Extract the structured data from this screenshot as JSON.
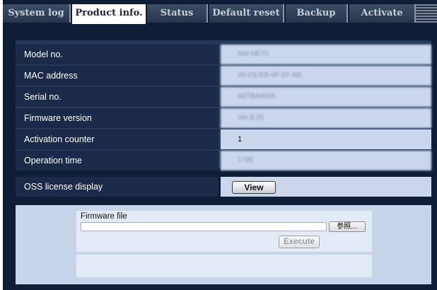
{
  "tabs": [
    {
      "label": "System log",
      "active": false
    },
    {
      "label": "Product info.",
      "active": true
    },
    {
      "label": "Status",
      "active": false
    },
    {
      "label": "Default reset",
      "active": false
    },
    {
      "label": "Backup",
      "active": false
    },
    {
      "label": "Activate",
      "active": false
    }
  ],
  "product_info": {
    "rows": [
      {
        "label": "Model no.",
        "value": "AW-HE70"
      },
      {
        "label": "MAC address",
        "value": "20-C6-EB-0F-07-AB"
      },
      {
        "label": "Serial no.",
        "value": "A0TBA0096"
      },
      {
        "label": "Firmware version",
        "value": "Ver.8.20"
      },
      {
        "label": "Activation counter",
        "value": "1"
      },
      {
        "label": "Operation time",
        "value": "1785"
      }
    ]
  },
  "oss": {
    "label": "OSS license display",
    "view_button": "View"
  },
  "firmware": {
    "file_label": "Firmware file",
    "file_value": "",
    "browse_button": "参照...",
    "execute_button": "Execute"
  },
  "colors": {
    "background": "#0e1e36",
    "label_cell": "#1a2a48",
    "value_cell": "#cad7eb",
    "panel": "#c7d5ea"
  }
}
